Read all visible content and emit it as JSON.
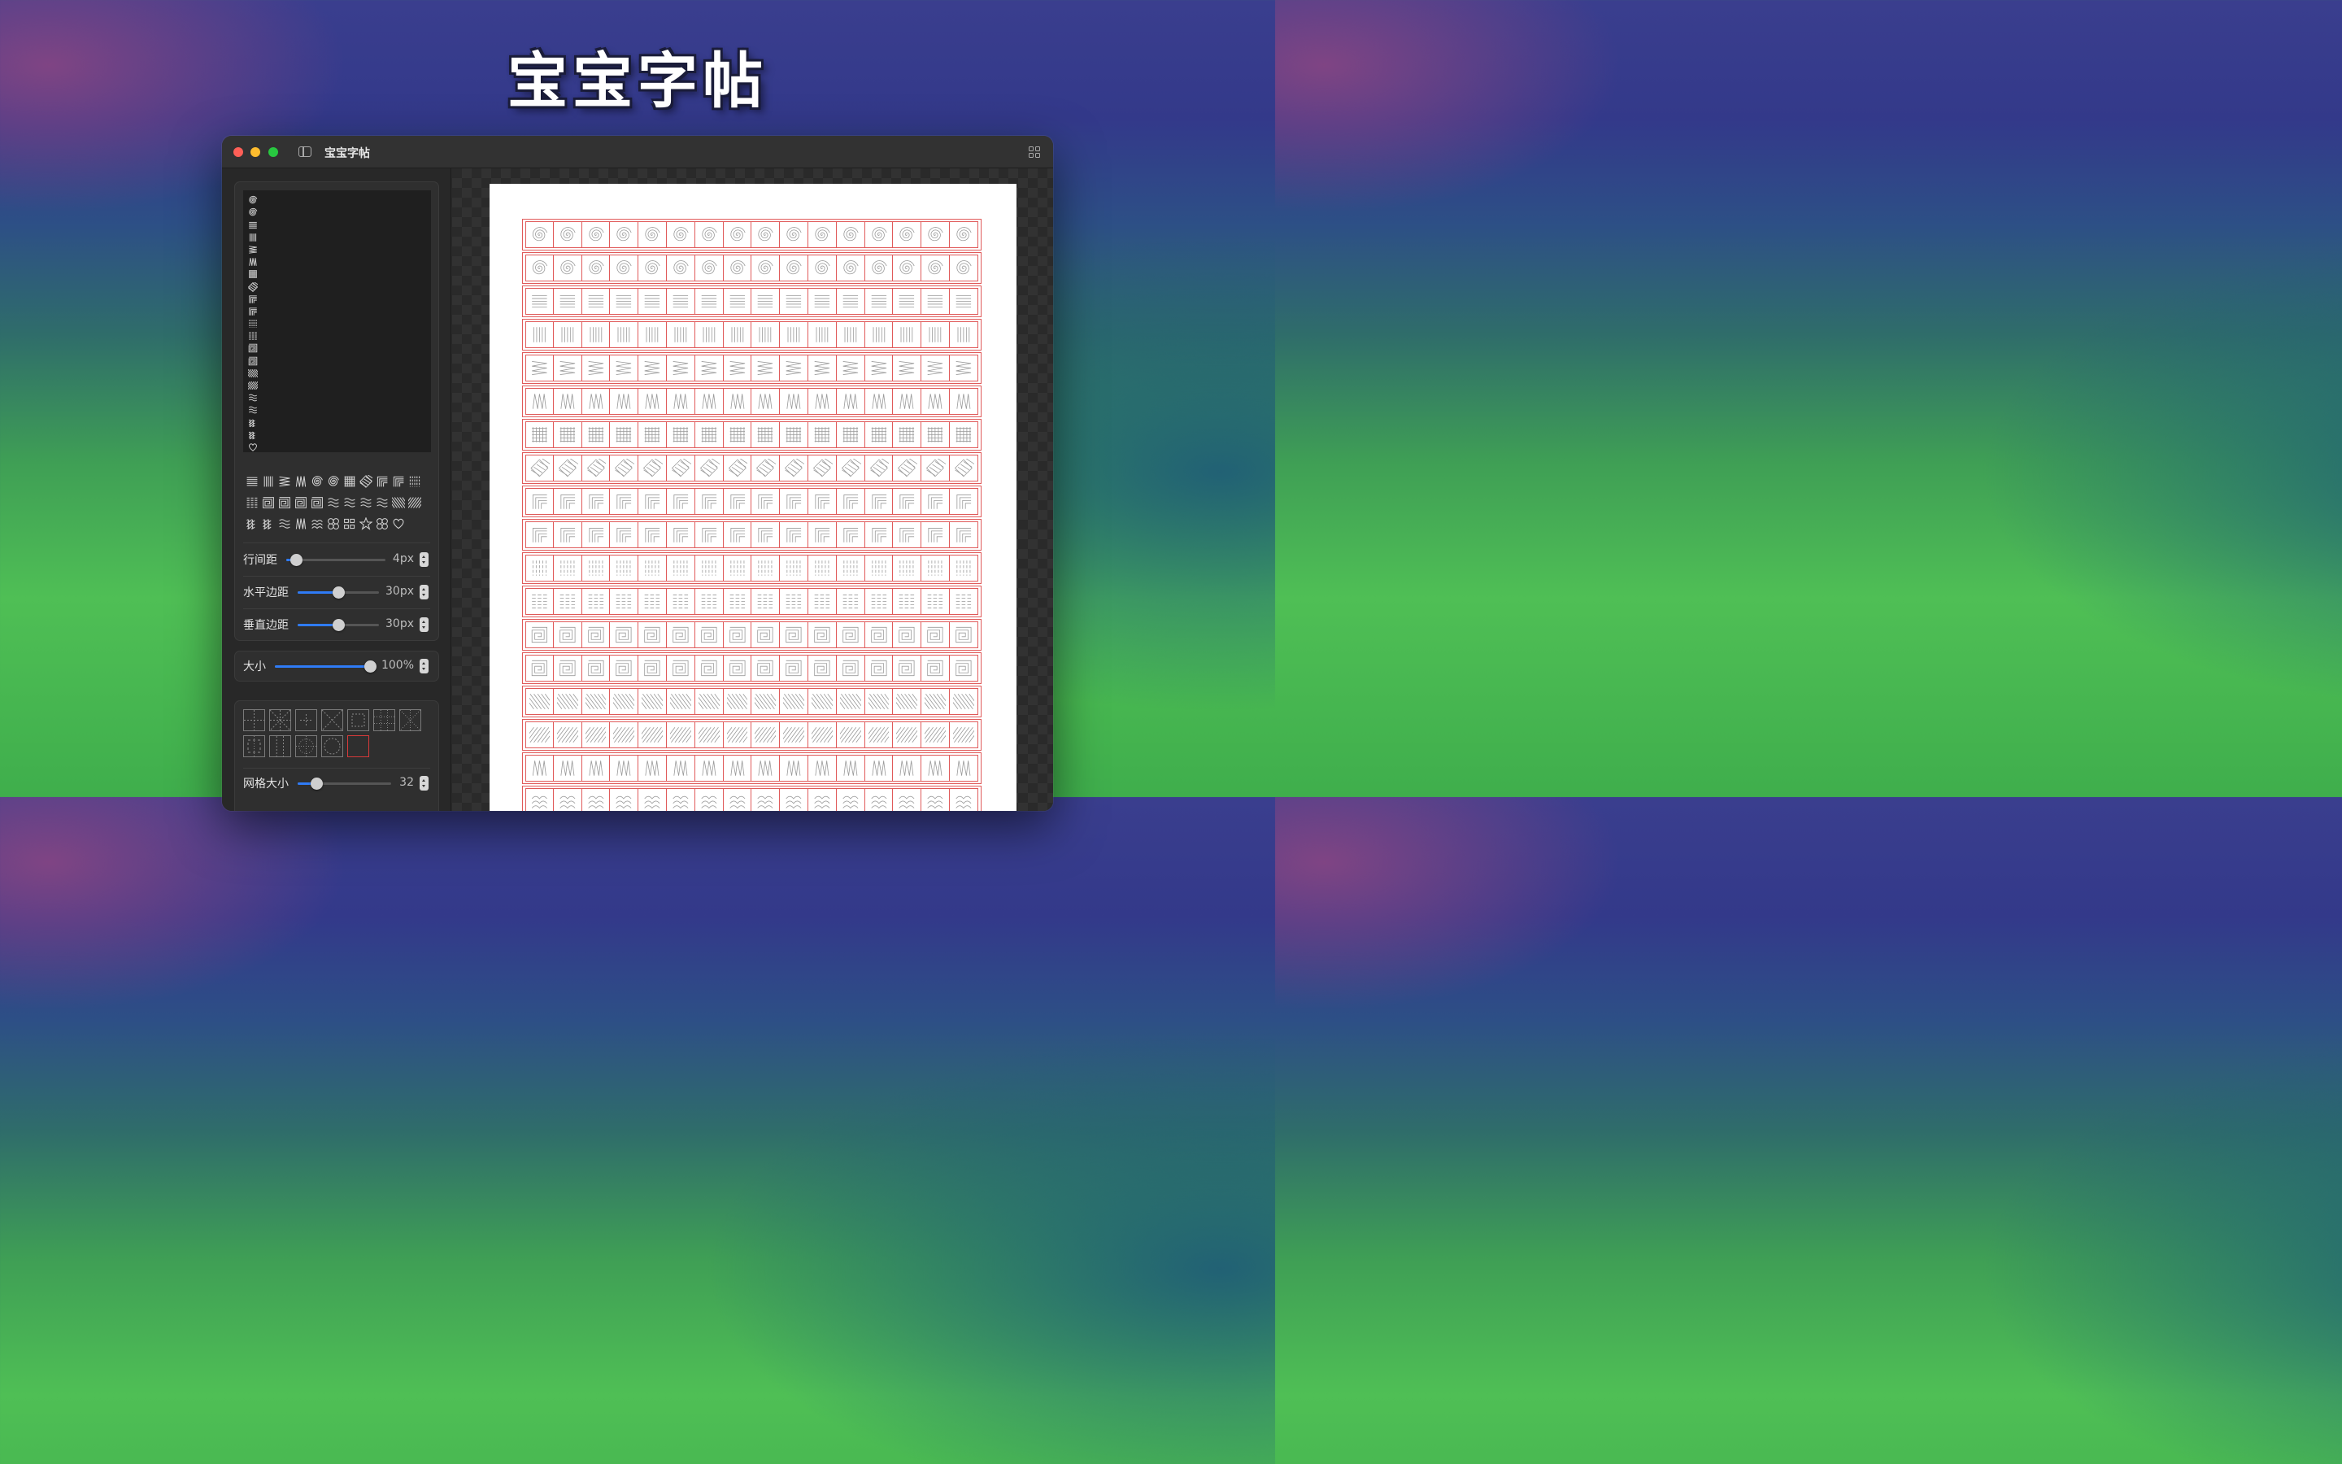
{
  "hero": {
    "title": "宝宝字帖"
  },
  "window": {
    "title": "宝宝字帖"
  },
  "preview_list": [
    "spiral-icon",
    "spiral-icon",
    "horizontal-lines-icon",
    "vertical-lines-icon",
    "zigzag-h-icon",
    "zigzag-v-icon",
    "grid-icon",
    "diamond-grid-icon",
    "corner-lines-icon",
    "corner-lines-2-icon",
    "dash-columns-icon",
    "dash-rows-icon",
    "square-spiral-icon",
    "square-spiral-2-icon",
    "diagonal-back-icon",
    "diagonal-fwd-icon",
    "wave-icon",
    "wave-2-icon",
    "loops-icon",
    "loops-2-icon",
    "heart-icon"
  ],
  "palette_rows": [
    [
      "horizontal-lines-icon",
      "vertical-lines-icon",
      "zigzag-h-icon",
      "zigzag-v-icon",
      "spiral-icon",
      "spiral-icon",
      "grid-icon",
      "diamond-grid-icon",
      "corner-lines-icon",
      "corner-lines-2-icon",
      "dash-columns-icon"
    ],
    [
      "dash-rows-icon",
      "square-spiral-icon",
      "square-spiral-2-icon",
      "meander-icon",
      "meander-2-icon",
      "zigzag-wave-icon",
      "zigzag-wave-2-icon",
      "wave-icon",
      "wave-cols-icon",
      "diagonal-back-icon",
      "diagonal-fwd-icon"
    ],
    [
      "loops-icon",
      "loops-2-icon",
      "wave-2-icon",
      "zigzag-v-icon",
      "arches-icon",
      "circles-icon",
      "squares-icon",
      "star-icon",
      "circles-2-icon",
      "heart-icon"
    ]
  ],
  "sliders": {
    "line_spacing": {
      "label": "行间距",
      "value": "4px",
      "fraction": 0.1
    },
    "h_margin": {
      "label": "水平边距",
      "value": "30px",
      "fraction": 0.5
    },
    "v_margin": {
      "label": "垂直边距",
      "value": "30px",
      "fraction": 0.5
    },
    "size": {
      "label": "大小",
      "value": "100%",
      "fraction": 1.0
    },
    "grid_size": {
      "label": "网格大小",
      "value": "32",
      "fraction": 0.2
    }
  },
  "grid_styles": [
    "tian-grid",
    "mi-grid",
    "cross-grid",
    "x-grid",
    "dashed-square",
    "dotted-grid",
    "dotted-x-grid",
    "dashed-corner",
    "dashed-rows",
    "dotted-circle",
    "circle",
    "plain-red"
  ],
  "sheet": {
    "columns": 16,
    "rows": [
      "spiral",
      "spiral",
      "hlines",
      "vlines",
      "zigzag-h",
      "zigzag-v",
      "grid",
      "diamond",
      "corner",
      "corner-2",
      "dash-cols",
      "dash-rows",
      "square-spiral",
      "square-spiral-2",
      "diag-back",
      "diag-fwd",
      "meander",
      "arches"
    ]
  },
  "colors": {
    "accent": "#2f7bf6",
    "sheet_line": "#e05a5a",
    "selected_grid": "#d63a3a"
  }
}
